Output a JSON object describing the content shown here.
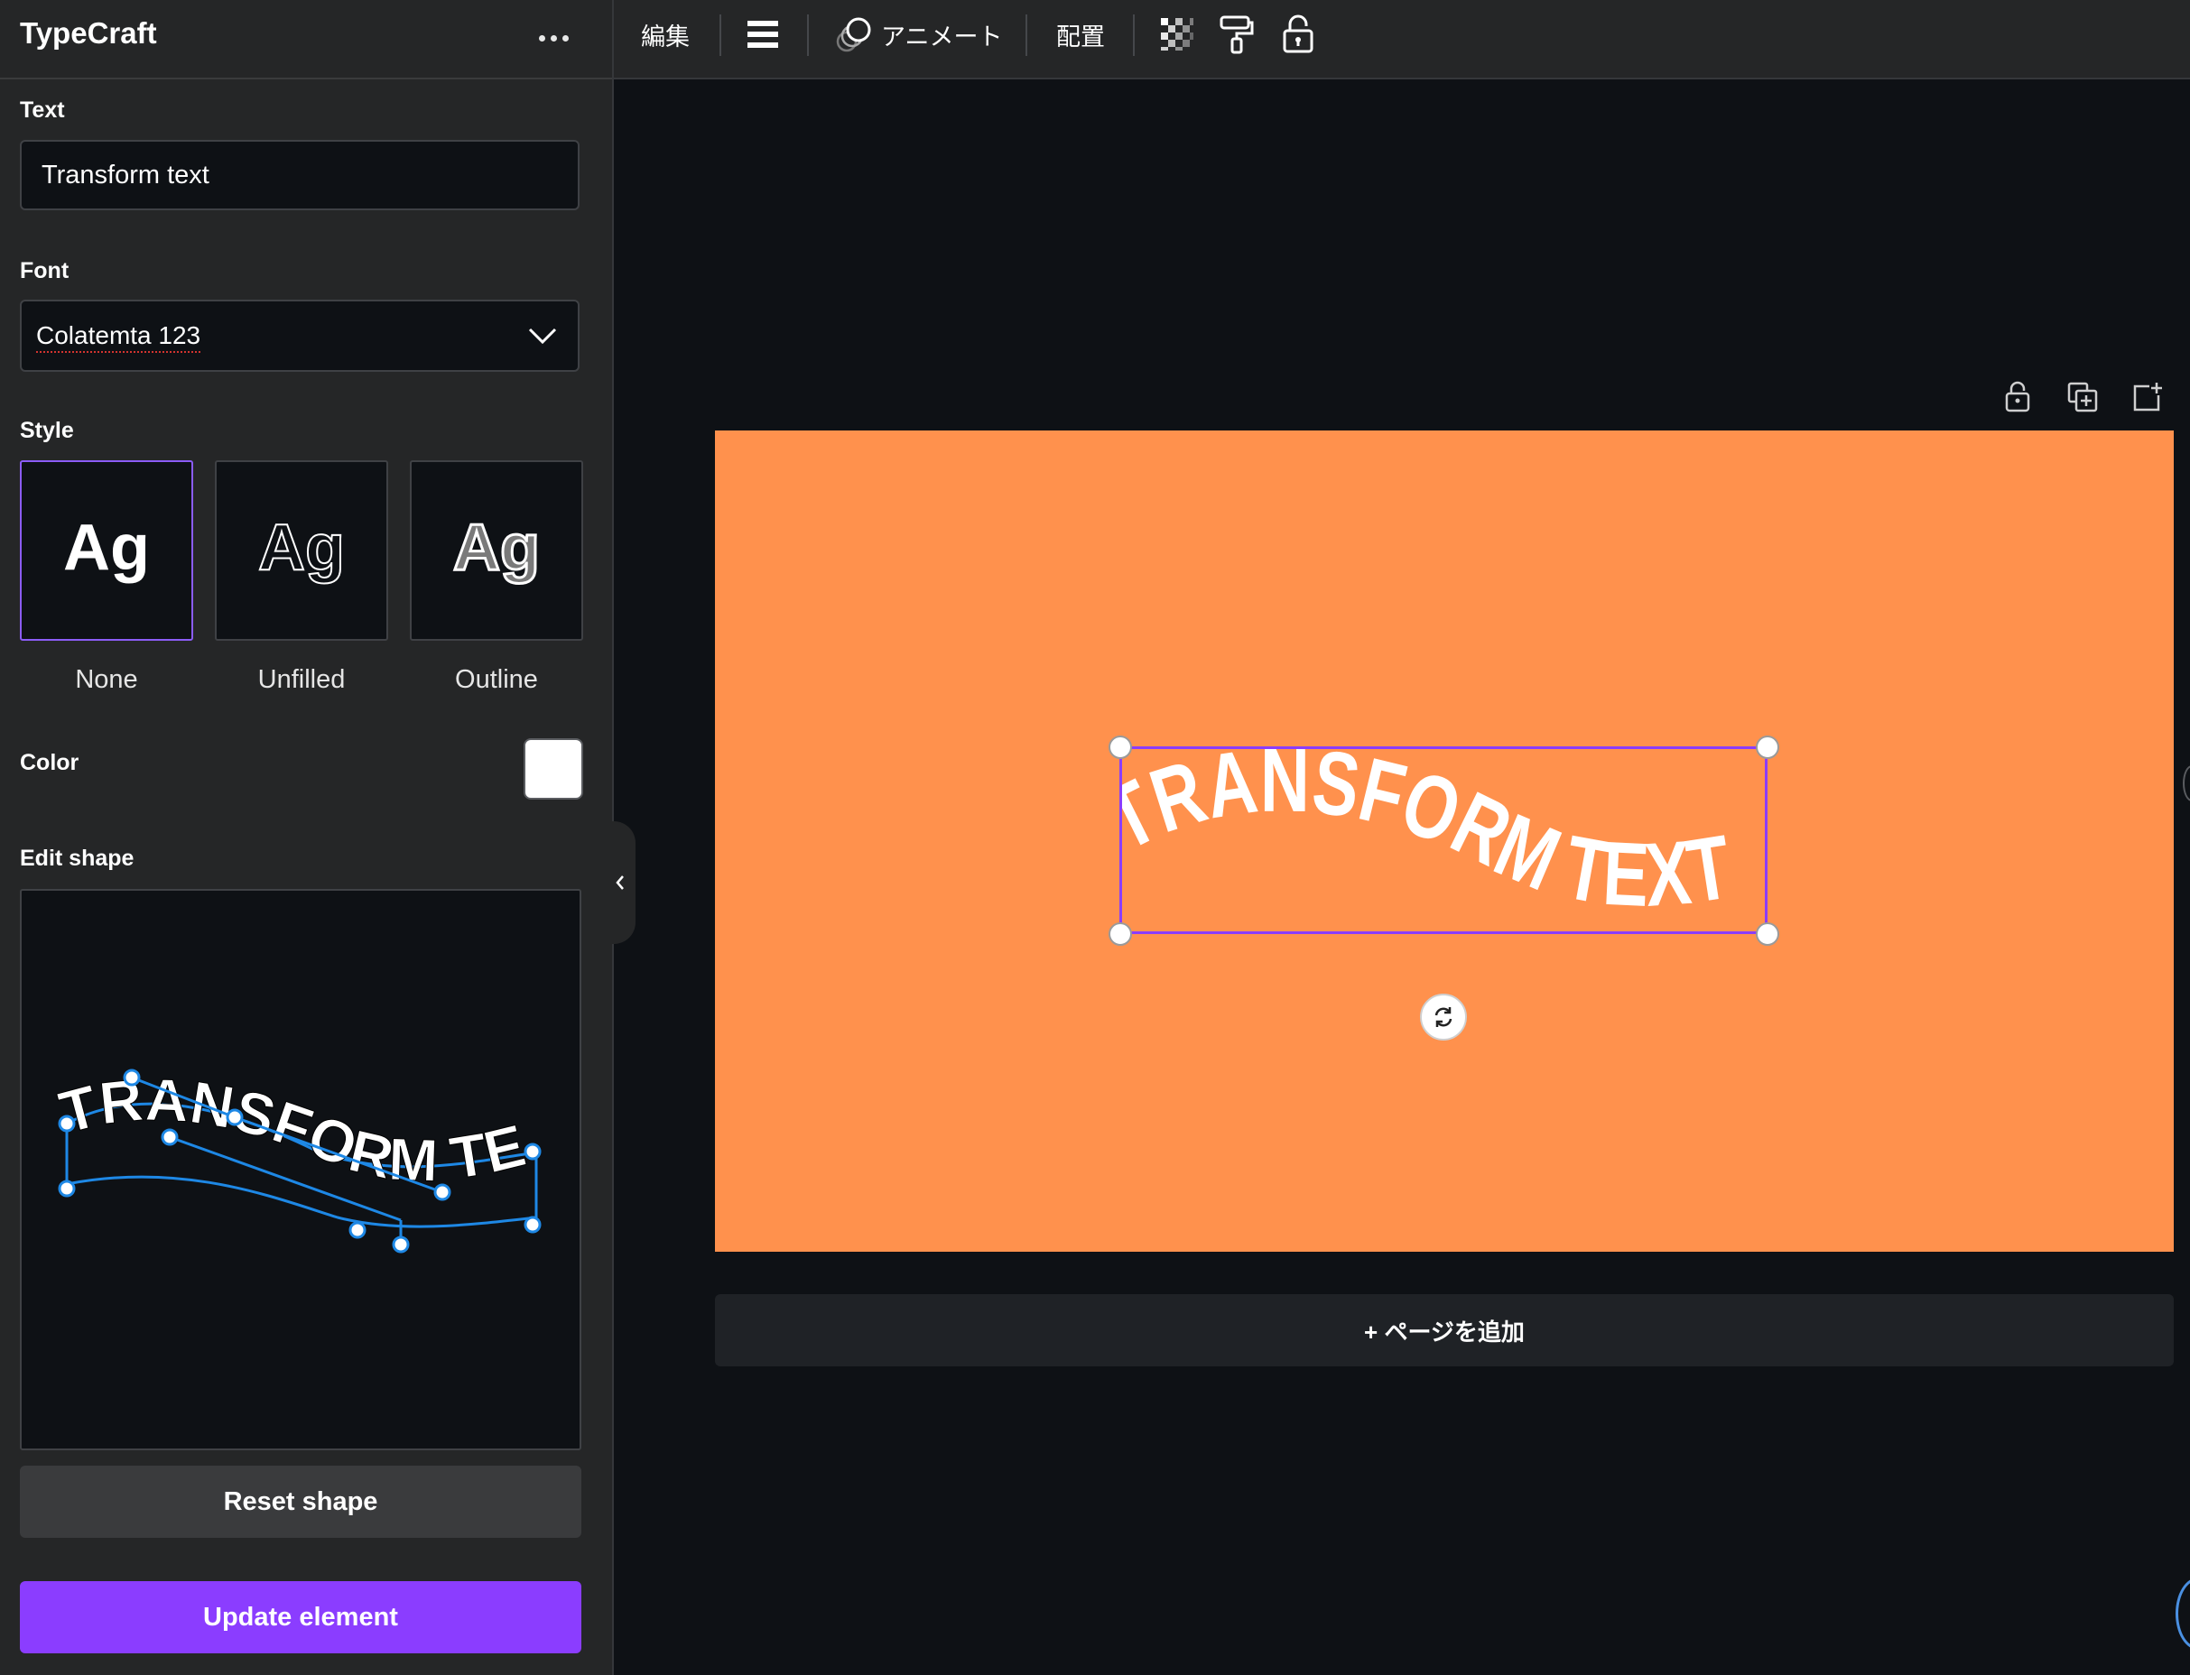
{
  "app": {
    "title": "TypeCraft"
  },
  "sidebar": {
    "text_label": "Text",
    "text_value": "Transform text",
    "font_label": "Font",
    "font_value": "Colatemta 123",
    "style_label": "Style",
    "style_options": [
      {
        "label": "None",
        "sample": "Ag",
        "selected": true
      },
      {
        "label": "Unfilled",
        "sample": "Ag",
        "selected": false
      },
      {
        "label": "Outline",
        "sample": "Ag",
        "selected": false
      }
    ],
    "color_label": "Color",
    "color_value": "#ffffff",
    "edit_shape_label": "Edit shape",
    "shape_preview_text": "TRANSFORM TEXT",
    "reset_button": "Reset shape",
    "update_button": "Update element"
  },
  "toolbar": {
    "edit": "編集",
    "animate": "アニメート",
    "position": "配置"
  },
  "canvas": {
    "element_text": "TRANSFORM TEXT",
    "page_background": "#ff914d",
    "add_page": "+ ページを追加"
  },
  "colors": {
    "accent": "#8b3dff",
    "sidebar_bg": "#252627",
    "canvas_bg": "#0e1115",
    "handle_blue": "#1e88e5"
  }
}
